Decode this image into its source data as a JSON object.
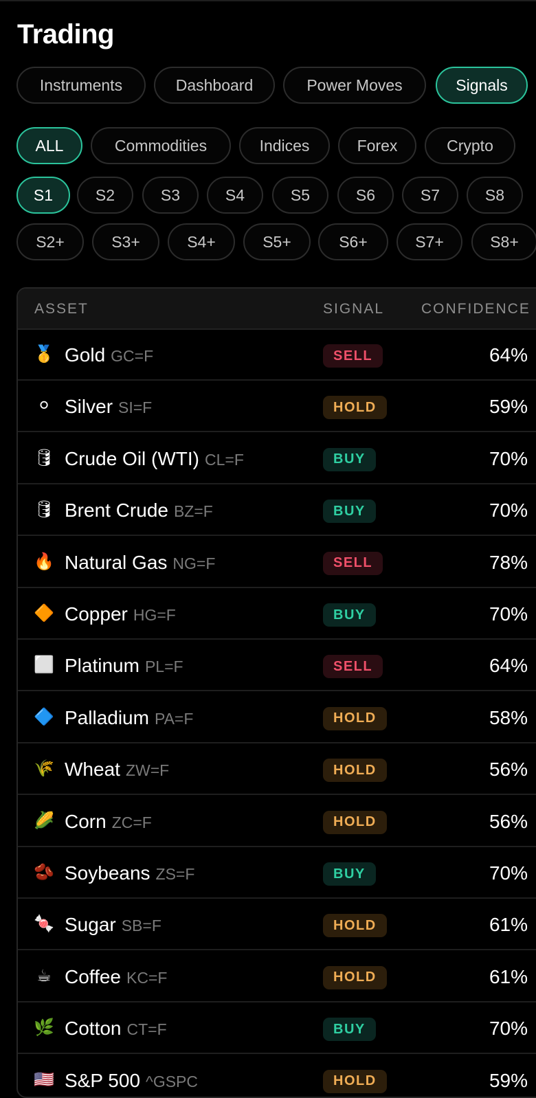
{
  "header": {
    "title": "Trading"
  },
  "tabs": [
    {
      "label": "Instruments",
      "active": false
    },
    {
      "label": "Dashboard",
      "active": false
    },
    {
      "label": "Power Moves",
      "active": false
    },
    {
      "label": "Signals",
      "active": true
    }
  ],
  "categories": [
    {
      "label": "ALL",
      "active": true
    },
    {
      "label": "Commodities",
      "active": false
    },
    {
      "label": "Indices",
      "active": false
    },
    {
      "label": "Forex",
      "active": false
    },
    {
      "label": "Crypto",
      "active": false
    }
  ],
  "strengths": [
    {
      "label": "S1",
      "active": true
    },
    {
      "label": "S2",
      "active": false
    },
    {
      "label": "S3",
      "active": false
    },
    {
      "label": "S4",
      "active": false
    },
    {
      "label": "S5",
      "active": false
    },
    {
      "label": "S6",
      "active": false
    },
    {
      "label": "S7",
      "active": false
    },
    {
      "label": "S8",
      "active": false
    }
  ],
  "strength_plus": [
    {
      "label": "S2+",
      "active": false
    },
    {
      "label": "S3+",
      "active": false
    },
    {
      "label": "S4+",
      "active": false
    },
    {
      "label": "S5+",
      "active": false
    },
    {
      "label": "S6+",
      "active": false
    },
    {
      "label": "S7+",
      "active": false
    },
    {
      "label": "S8+",
      "active": false
    }
  ],
  "table": {
    "columns": [
      "ASSET",
      "SIGNAL",
      "CONFIDENCE"
    ],
    "rows": [
      {
        "icon": "🥇",
        "icon_name": "gold-medal-icon",
        "name": "Gold",
        "ticker": "GC=F",
        "signal": "SELL",
        "confidence": "64%"
      },
      {
        "icon": "⚪",
        "icon_name": "white-circle-icon",
        "name": "Silver",
        "ticker": "SI=F",
        "signal": "HOLD",
        "confidence": "59%"
      },
      {
        "icon": "🛢",
        "icon_name": "oil-drum-icon",
        "name": "Crude Oil (WTI)",
        "ticker": "CL=F",
        "signal": "BUY",
        "confidence": "70%"
      },
      {
        "icon": "🛢",
        "icon_name": "oil-drum-icon",
        "name": "Brent Crude",
        "ticker": "BZ=F",
        "signal": "BUY",
        "confidence": "70%"
      },
      {
        "icon": "🔥",
        "icon_name": "fire-icon",
        "name": "Natural Gas",
        "ticker": "NG=F",
        "signal": "SELL",
        "confidence": "78%"
      },
      {
        "icon": "🔶",
        "icon_name": "orange-diamond-icon",
        "name": "Copper",
        "ticker": "HG=F",
        "signal": "BUY",
        "confidence": "70%"
      },
      {
        "icon": "⬜",
        "icon_name": "white-square-icon",
        "name": "Platinum",
        "ticker": "PL=F",
        "signal": "SELL",
        "confidence": "64%"
      },
      {
        "icon": "🔷",
        "icon_name": "blue-diamond-icon",
        "name": "Palladium",
        "ticker": "PA=F",
        "signal": "HOLD",
        "confidence": "58%"
      },
      {
        "icon": "🌾",
        "icon_name": "wheat-icon",
        "name": "Wheat",
        "ticker": "ZW=F",
        "signal": "HOLD",
        "confidence": "56%"
      },
      {
        "icon": "🌽",
        "icon_name": "corn-icon",
        "name": "Corn",
        "ticker": "ZC=F",
        "signal": "HOLD",
        "confidence": "56%"
      },
      {
        "icon": "🫘",
        "icon_name": "beans-icon",
        "name": "Soybeans",
        "ticker": "ZS=F",
        "signal": "BUY",
        "confidence": "70%"
      },
      {
        "icon": "🍬",
        "icon_name": "candy-icon",
        "name": "Sugar",
        "ticker": "SB=F",
        "signal": "HOLD",
        "confidence": "61%"
      },
      {
        "icon": "☕",
        "icon_name": "coffee-icon",
        "name": "Coffee",
        "ticker": "KC=F",
        "signal": "HOLD",
        "confidence": "61%"
      },
      {
        "icon": "🌿",
        "icon_name": "herb-icon",
        "name": "Cotton",
        "ticker": "CT=F",
        "signal": "BUY",
        "confidence": "70%"
      },
      {
        "icon": "🇺🇸",
        "icon_name": "us-flag-icon",
        "name": "S&P 500",
        "ticker": "^GSPC",
        "signal": "HOLD",
        "confidence": "59%"
      }
    ]
  },
  "colors": {
    "accent": "#2bc49c",
    "sell": "#f0506a",
    "hold": "#f0ad55",
    "buy": "#2fcfa2"
  }
}
